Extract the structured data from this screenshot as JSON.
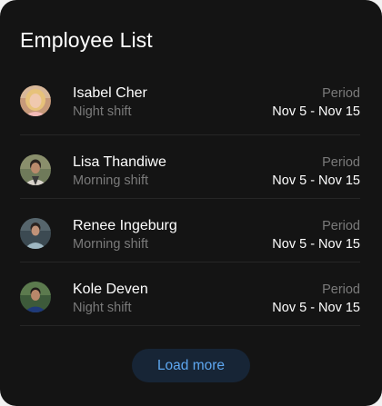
{
  "header": {
    "title": "Employee List"
  },
  "employees": [
    {
      "name": "Isabel Cher",
      "shift": "Night shift",
      "period_label": "Period",
      "period": "Nov 5 - Nov 15"
    },
    {
      "name": "Lisa Thandiwe",
      "shift": "Morning shift",
      "period_label": "Period",
      "period": "Nov 5 - Nov 15"
    },
    {
      "name": "Renee Ingeburg",
      "shift": "Morning shift",
      "period_label": "Period",
      "period": "Nov 5 - Nov 15"
    },
    {
      "name": "Kole Deven",
      "shift": "Night shift",
      "period_label": "Period",
      "period": "Nov 5 - Nov 15"
    }
  ],
  "footer": {
    "load_more_label": "Load more"
  },
  "colors": {
    "card_background": "#141414",
    "text_primary": "#ffffff",
    "text_secondary": "#7a7a7a",
    "divider": "#262626",
    "button_background": "#172536",
    "button_text": "#5ea7f0"
  }
}
